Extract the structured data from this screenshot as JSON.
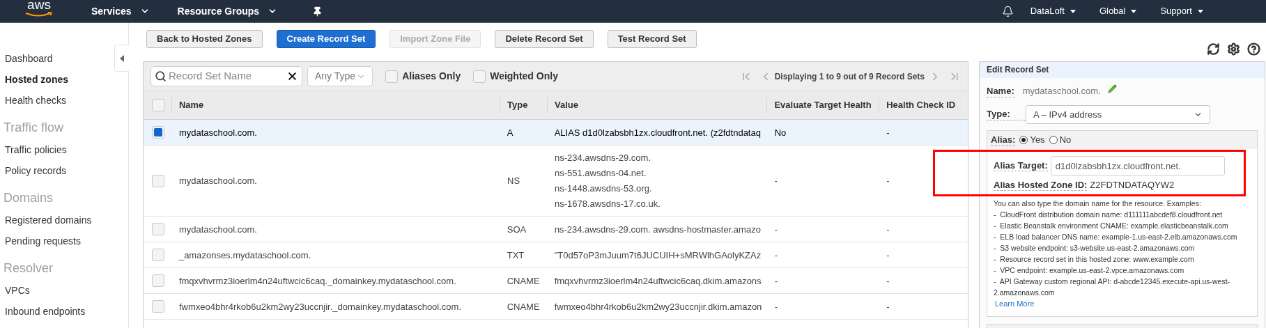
{
  "top_nav": {
    "logo": "aws",
    "menus": [
      {
        "label": "Services"
      },
      {
        "label": "Resource Groups"
      }
    ],
    "account_menus": [
      {
        "label": "DataLoft"
      },
      {
        "label": "Global"
      },
      {
        "label": "Support"
      }
    ]
  },
  "sidebar": {
    "sections": [
      {
        "items": [
          {
            "label": "Dashboard",
            "selected": false
          },
          {
            "label": "Hosted zones",
            "selected": true
          },
          {
            "label": "Health checks",
            "selected": false
          }
        ]
      },
      {
        "heading": "Traffic flow",
        "items": [
          {
            "label": "Traffic policies",
            "selected": false
          },
          {
            "label": "Policy records",
            "selected": false
          }
        ]
      },
      {
        "heading": "Domains",
        "items": [
          {
            "label": "Registered domains",
            "selected": false
          },
          {
            "label": "Pending requests",
            "selected": false
          }
        ]
      },
      {
        "heading": "Resolver",
        "items": [
          {
            "label": "VPCs",
            "selected": false
          },
          {
            "label": "Inbound endpoints",
            "selected": false
          }
        ]
      }
    ]
  },
  "toolbar": {
    "buttons": [
      {
        "label": "Back to Hosted Zones",
        "kind": "default",
        "disabled": false
      },
      {
        "label": "Create Record Set",
        "kind": "primary",
        "disabled": false
      },
      {
        "label": "Import Zone File",
        "kind": "default",
        "disabled": true
      },
      {
        "label": "Delete Record Set",
        "kind": "default",
        "disabled": false
      },
      {
        "label": "Test Record Set",
        "kind": "default",
        "disabled": false
      }
    ]
  },
  "filter": {
    "search_placeholder": "Record Set Name",
    "type_filter": "Any Type",
    "checkboxes": [
      {
        "label": "Aliases Only",
        "checked": false
      },
      {
        "label": "Weighted Only",
        "checked": false
      }
    ],
    "pagination": "Displaying 1 to 9 out of 9 Record Sets"
  },
  "table": {
    "select_all_checked": false,
    "columns": [
      "Name",
      "Type",
      "Value",
      "Evaluate Target Health",
      "Health Check ID"
    ],
    "rows": [
      {
        "selected": true,
        "name": "mydataschool.com.",
        "type": "A",
        "value": [
          "ALIAS d1d0lzabsbh1zx.cloudfront.net. (z2fdtndataq"
        ],
        "evaluate_target_health": "No",
        "health_check_id": "-"
      },
      {
        "selected": false,
        "name": "mydataschool.com.",
        "type": "NS",
        "value": [
          "ns-234.awsdns-29.com.",
          "ns-551.awsdns-04.net.",
          "ns-1448.awsdns-53.org.",
          "ns-1678.awsdns-17.co.uk."
        ],
        "evaluate_target_health": "-",
        "health_check_id": "-"
      },
      {
        "selected": false,
        "name": "mydataschool.com.",
        "type": "SOA",
        "value": [
          "ns-234.awsdns-29.com. awsdns-hostmaster.amazo"
        ],
        "evaluate_target_health": "-",
        "health_check_id": "-"
      },
      {
        "selected": false,
        "name": "_amazonses.mydataschool.com.",
        "type": "TXT",
        "value": [
          "\"T0d57oP3mJuum7t6JUCUIH+sMRWlhGAolyKZAz"
        ],
        "evaluate_target_health": "-",
        "health_check_id": "-"
      },
      {
        "selected": false,
        "name": "fmqxvhvrmz3ioerlm4n24uftwcic6caq._domainkey.mydataschool.com.",
        "type": "CNAME",
        "value": [
          "fmqxvhvrmz3ioerlm4n24uftwcic6caq.dkim.amazons"
        ],
        "evaluate_target_health": "-",
        "health_check_id": "-"
      },
      {
        "selected": false,
        "name": "fwmxeo4bhr4rkob6u2km2wy23uccnjir._domainkey.mydataschool.com.",
        "type": "CNAME",
        "value": [
          "fwmxeo4bhr4rkob6u2km2wy23uccnjir.dkim.amazon"
        ],
        "evaluate_target_health": "-",
        "health_check_id": "-"
      }
    ]
  },
  "edit_panel": {
    "title": "Edit Record Set",
    "name_label": "Name:",
    "name_value": "mydataschool.com.",
    "type_label": "Type:",
    "type_value": "A – IPv4 address",
    "alias_label": "Alias:",
    "alias_options": [
      {
        "label": "Yes",
        "selected": true
      },
      {
        "label": "No",
        "selected": false
      }
    ],
    "alias_target_label": "Alias Target:",
    "alias_target_value": "d1d0lzabsbh1zx.cloudfront.net.",
    "zone_id_label": "Alias Hosted Zone ID:",
    "zone_id_value": "Z2FDTNDATAQYW2",
    "help_intro": "You can also type the domain name for the resource. Examples:",
    "help_items": [
      "-  CloudFront distribution domain name: d111111abcdef8.cloudfront.net",
      "-  Elastic Beanstalk environment CNAME: example.elasticbeanstalk.com",
      "-  ELB load balancer DNS name: example-1.us-east-2.elb.amazonaws.com",
      "-  S3 website endpoint: s3-website.us-east-2.amazonaws.com",
      "-  Resource record set in this hosted zone: www.example.com",
      "-  VPC endpoint: example.us-east-2.vpce.amazonaws.com",
      "-  API Gateway custom regional API: d-abcde12345.execute-api.us-west-2.amazonaws.com"
    ],
    "learn_more": "Learn More"
  }
}
